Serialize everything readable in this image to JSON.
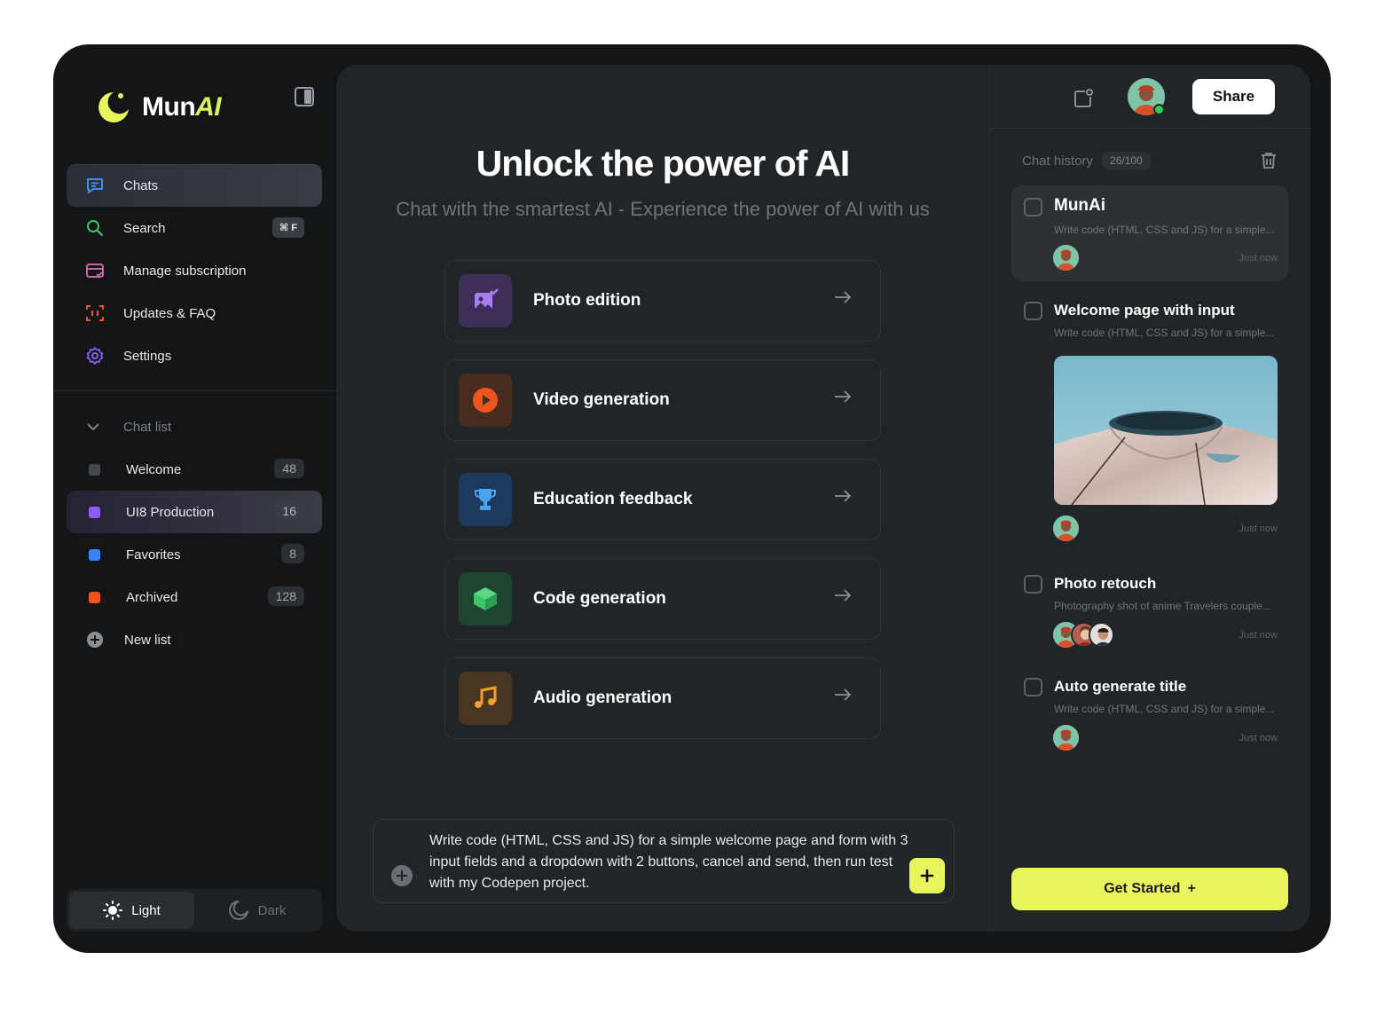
{
  "brand": {
    "name": "Mun",
    "name_accent": "AI"
  },
  "nav": [
    {
      "label": "Chats",
      "icon": "chat-bubble-icon",
      "active": true
    },
    {
      "label": "Search",
      "icon": "search-icon",
      "shortcut": "⌘ F"
    },
    {
      "label": "Manage subscription",
      "icon": "card-icon"
    },
    {
      "label": "Updates & FAQ",
      "icon": "scan-icon"
    },
    {
      "label": "Settings",
      "icon": "gear-icon"
    }
  ],
  "chat_list": {
    "header": "Chat list",
    "items": [
      {
        "label": "Welcome",
        "count": "48",
        "color": "#45484d"
      },
      {
        "label": "UI8 Production",
        "count": "16",
        "color": "#8b5cf6",
        "active": true
      },
      {
        "label": "Favorites",
        "count": "8",
        "color": "#3b82f6"
      },
      {
        "label": "Archived",
        "count": "128",
        "color": "#f0541e"
      }
    ],
    "new_list": "New list"
  },
  "theme": {
    "light": "Light",
    "dark": "Dark",
    "selected": "Light"
  },
  "main": {
    "title": "Unlock the power of AI",
    "subtitle": "Chat with the smartest AI - Experience the power of AI with us",
    "cards": [
      {
        "label": "Photo edition",
        "icon": "photo-edit-icon",
        "bg": "#3d2f57",
        "color": "#a87cf0"
      },
      {
        "label": "Video generation",
        "icon": "play-icon",
        "bg": "#4a2b1f",
        "color": "#f0541e"
      },
      {
        "label": "Education feedback",
        "icon": "trophy-icon",
        "bg": "#1d3a5e",
        "color": "#4aa3f0"
      },
      {
        "label": "Code generation",
        "icon": "cube-icon",
        "bg": "#1f4430",
        "color": "#3ec46a"
      },
      {
        "label": "Audio generation",
        "icon": "music-icon",
        "bg": "#4a3520",
        "color": "#f0a030"
      }
    ],
    "composer_text": "Write code (HTML, CSS and JS) for a simple welcome page and form with 3 input fields and a dropdown with 2 buttons, cancel and send, then run test with my Codepen project."
  },
  "right": {
    "share": "Share",
    "history_label": "Chat history",
    "history_count": "26/100",
    "items": [
      {
        "title": "MunAi",
        "desc": "Write code (HTML, CSS and JS) for a simple...",
        "time": "Just now"
      },
      {
        "title": "Welcome page with input",
        "desc": "Write code (HTML, CSS and JS) for a simple...",
        "time": "Just now"
      },
      {
        "title": "Photo retouch",
        "desc": "Photography shot of anime Travelers couple...",
        "time": "Just now"
      },
      {
        "title": "Auto generate title",
        "desc": "Write code (HTML, CSS and JS) for a simple...",
        "time": "Just now"
      }
    ],
    "get_started": "Get Started",
    "get_started_icon": "+"
  }
}
